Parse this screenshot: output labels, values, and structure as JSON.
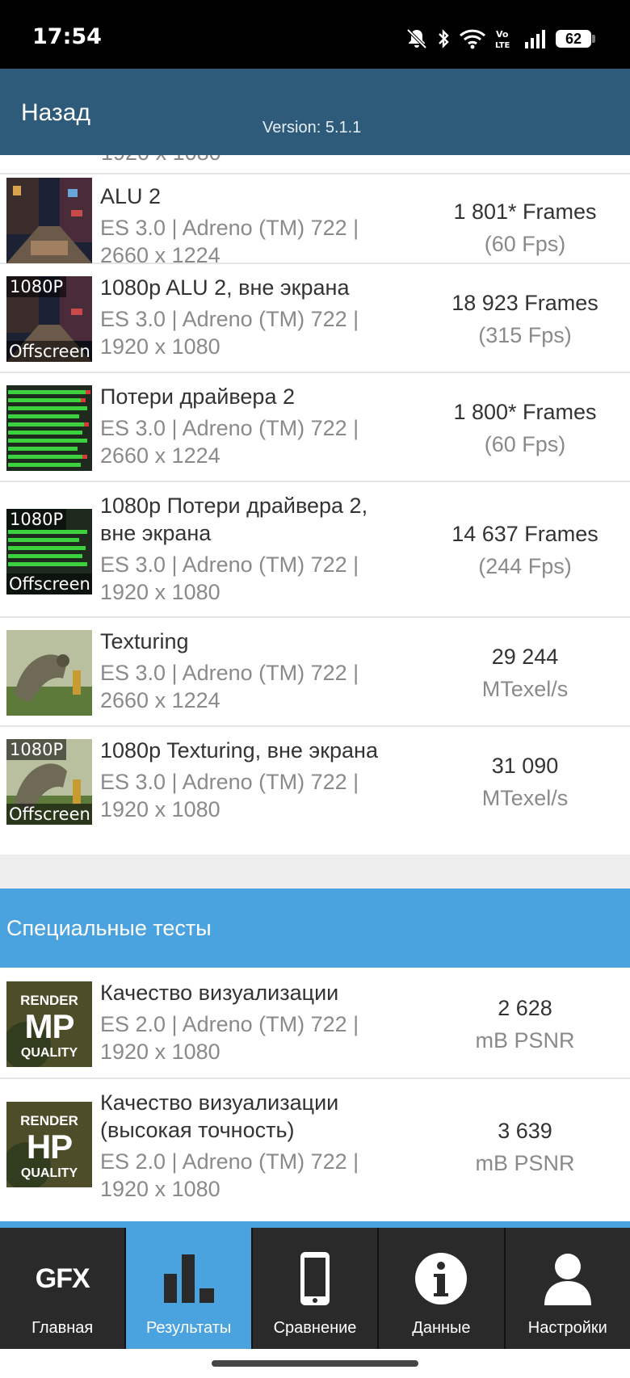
{
  "status_bar": {
    "time": "17:54",
    "battery": "62"
  },
  "header": {
    "back": "Назад",
    "version": "Version: 5.1.1"
  },
  "partial_row_text": "1920 x 1080",
  "rows": [
    {
      "title": "ALU 2",
      "api": "ES 3.0 | Adreno (TM) 722 |",
      "resolution": "2660 x 1224",
      "result": "1 801* Frames",
      "result_sub": "(60 Fps)"
    },
    {
      "title": "1080p ALU 2, вне экрана",
      "api": "ES 3.0 | Adreno (TM) 722 |",
      "resolution": "1920 x 1080",
      "result": "18 923 Frames",
      "result_sub": "(315 Fps)",
      "badge_top": "1080P",
      "badge_bottom": "Offscreen"
    },
    {
      "title": "Потери драйвера 2",
      "api": "ES 3.0 | Adreno (TM) 722 |",
      "resolution": "2660 x 1224",
      "result": "1 800* Frames",
      "result_sub": "(60 Fps)"
    },
    {
      "title": "1080p Потери драйвера 2,",
      "title2": "вне экрана",
      "api": "ES 3.0 | Adreno (TM) 722 |",
      "resolution": "1920 x 1080",
      "result": "14 637 Frames",
      "result_sub": "(244 Fps)",
      "badge_top": "1080P",
      "badge_bottom": "Offscreen"
    },
    {
      "title": "Texturing",
      "api": "ES 3.0 | Adreno (TM) 722 |",
      "resolution": "2660 x 1224",
      "result": "29 244",
      "result_sub": "MTexel/s"
    },
    {
      "title": "1080p Texturing, вне экрана",
      "api": "ES 3.0 | Adreno (TM) 722 |",
      "resolution": "1920 x 1080",
      "result": "31 090",
      "result_sub": "MTexel/s",
      "badge_top": "1080P",
      "badge_bottom": "Offscreen"
    }
  ],
  "special_section": {
    "title": "Специальные тесты"
  },
  "special_rows": [
    {
      "title": "Качество визуализации",
      "api": "ES 2.0 | Adreno (TM) 722 |",
      "resolution": "1920 x 1080",
      "result": "2 628",
      "result_sub": "mB PSNR",
      "icon_top": "RENDER",
      "icon_mid": "MP",
      "icon_bottom": "QUALITY"
    },
    {
      "title": "Качество визуализации",
      "title2": "(высокая точность)",
      "api": "ES 2.0 | Adreno (TM) 722 |",
      "resolution": "1920 x 1080",
      "result": "3 639",
      "result_sub": "mB PSNR",
      "icon_top": "RENDER",
      "icon_mid": "HP",
      "icon_bottom": "QUALITY"
    }
  ],
  "nav": {
    "items": [
      {
        "label": "Главная",
        "icon_text": "GFX"
      },
      {
        "label": "Результаты"
      },
      {
        "label": "Сравнение"
      },
      {
        "label": "Данные"
      },
      {
        "label": "Настройки"
      }
    ],
    "active": "Результаты"
  },
  "colors": {
    "app_bar": "#2e5b7a",
    "accent": "#4aa3df",
    "nav_bg": "#2a2a2a"
  }
}
